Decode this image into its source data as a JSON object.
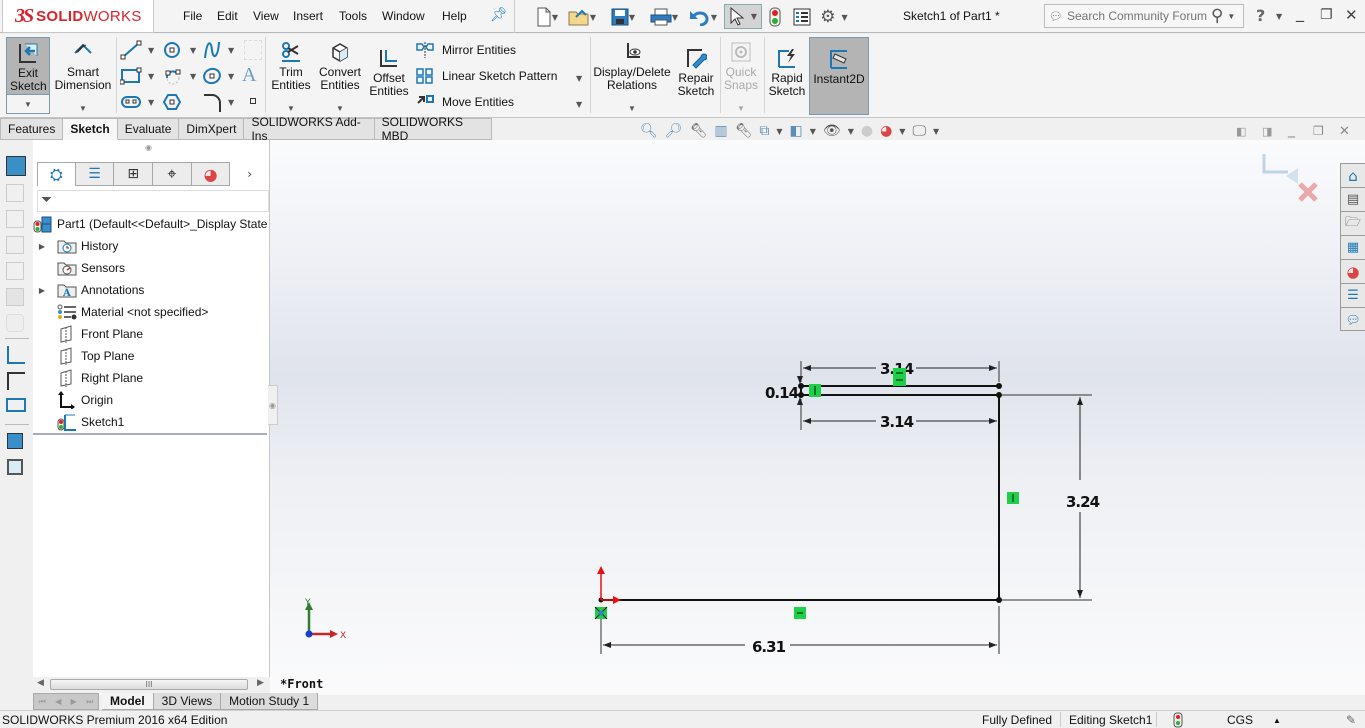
{
  "app": {
    "logo_ds": "3S",
    "logo_bold": "SOLID",
    "logo_light": "WORKS",
    "document_title": "Sketch1 of Part1 *"
  },
  "menu": [
    "File",
    "Edit",
    "View",
    "Insert",
    "Tools",
    "Window",
    "Help"
  ],
  "search": {
    "placeholder": "Search Community Forum"
  },
  "window_controls": {
    "help": "?",
    "minimize": "_",
    "restore": "❐",
    "close": "✕"
  },
  "ribbon": {
    "exit_sketch": "Exit Sketch",
    "smart_dimension": "Smart Dimension",
    "trim_entities": "Trim Entities",
    "convert_entities": "Convert Entities",
    "offset_entities": "Offset Entities",
    "mirror_entities": "Mirror Entities",
    "linear_sketch_pattern": "Linear Sketch Pattern",
    "move_entities": "Move Entities",
    "display_delete_relations": "Display/Delete Relations",
    "repair_sketch": "Repair Sketch",
    "quick_snaps": "Quick Snaps",
    "rapid_sketch": "Rapid Sketch",
    "instant2d": "Instant2D"
  },
  "command_tabs": [
    {
      "label": "Features",
      "active": false
    },
    {
      "label": "Sketch",
      "active": true
    },
    {
      "label": "Evaluate",
      "active": false
    },
    {
      "label": "DimXpert",
      "active": false
    },
    {
      "label": "SOLIDWORKS Add-Ins",
      "active": false
    },
    {
      "label": "SOLIDWORKS MBD",
      "active": false
    }
  ],
  "feature_tree": {
    "root": "Part1  (Default<<Default>_Display State",
    "items": [
      {
        "label": "History",
        "icon": "history-folder-icon",
        "expandable": true
      },
      {
        "label": "Sensors",
        "icon": "sensors-folder-icon",
        "expandable": false
      },
      {
        "label": "Annotations",
        "icon": "annotations-folder-icon",
        "expandable": true
      },
      {
        "label": "Material <not specified>",
        "icon": "material-icon",
        "expandable": false
      },
      {
        "label": "Front Plane",
        "icon": "plane-icon",
        "expandable": false
      },
      {
        "label": "Top Plane",
        "icon": "plane-icon",
        "expandable": false
      },
      {
        "label": "Right Plane",
        "icon": "plane-icon",
        "expandable": false
      },
      {
        "label": "Origin",
        "icon": "origin-icon",
        "expandable": false
      },
      {
        "label": "Sketch1",
        "icon": "sketch-icon",
        "expandable": false
      }
    ]
  },
  "viewport": {
    "view_name": "*Front",
    "triad": {
      "x": "X",
      "y": "Y"
    },
    "dimensions": {
      "top_length": "3.14",
      "thickness": "0.14",
      "inner_length": "3.14",
      "height": "3.24",
      "base_length": "6.31"
    }
  },
  "bottom_tabs": [
    {
      "label": "Model",
      "active": true
    },
    {
      "label": "3D Views",
      "active": false
    },
    {
      "label": "Motion Study 1",
      "active": false
    }
  ],
  "scrollbar_grip": "III",
  "status": {
    "edition": "SOLIDWORKS Premium 2016 x64 Edition",
    "definition": "Fully Defined",
    "mode": "Editing Sketch1",
    "units": "CGS",
    "units_arrow": "▲"
  },
  "colors": {
    "brand_red": "#d8232a",
    "relation_green": "#1ed047",
    "active_button": "#b4b4b4",
    "icon_blue": "#1b78b4"
  }
}
